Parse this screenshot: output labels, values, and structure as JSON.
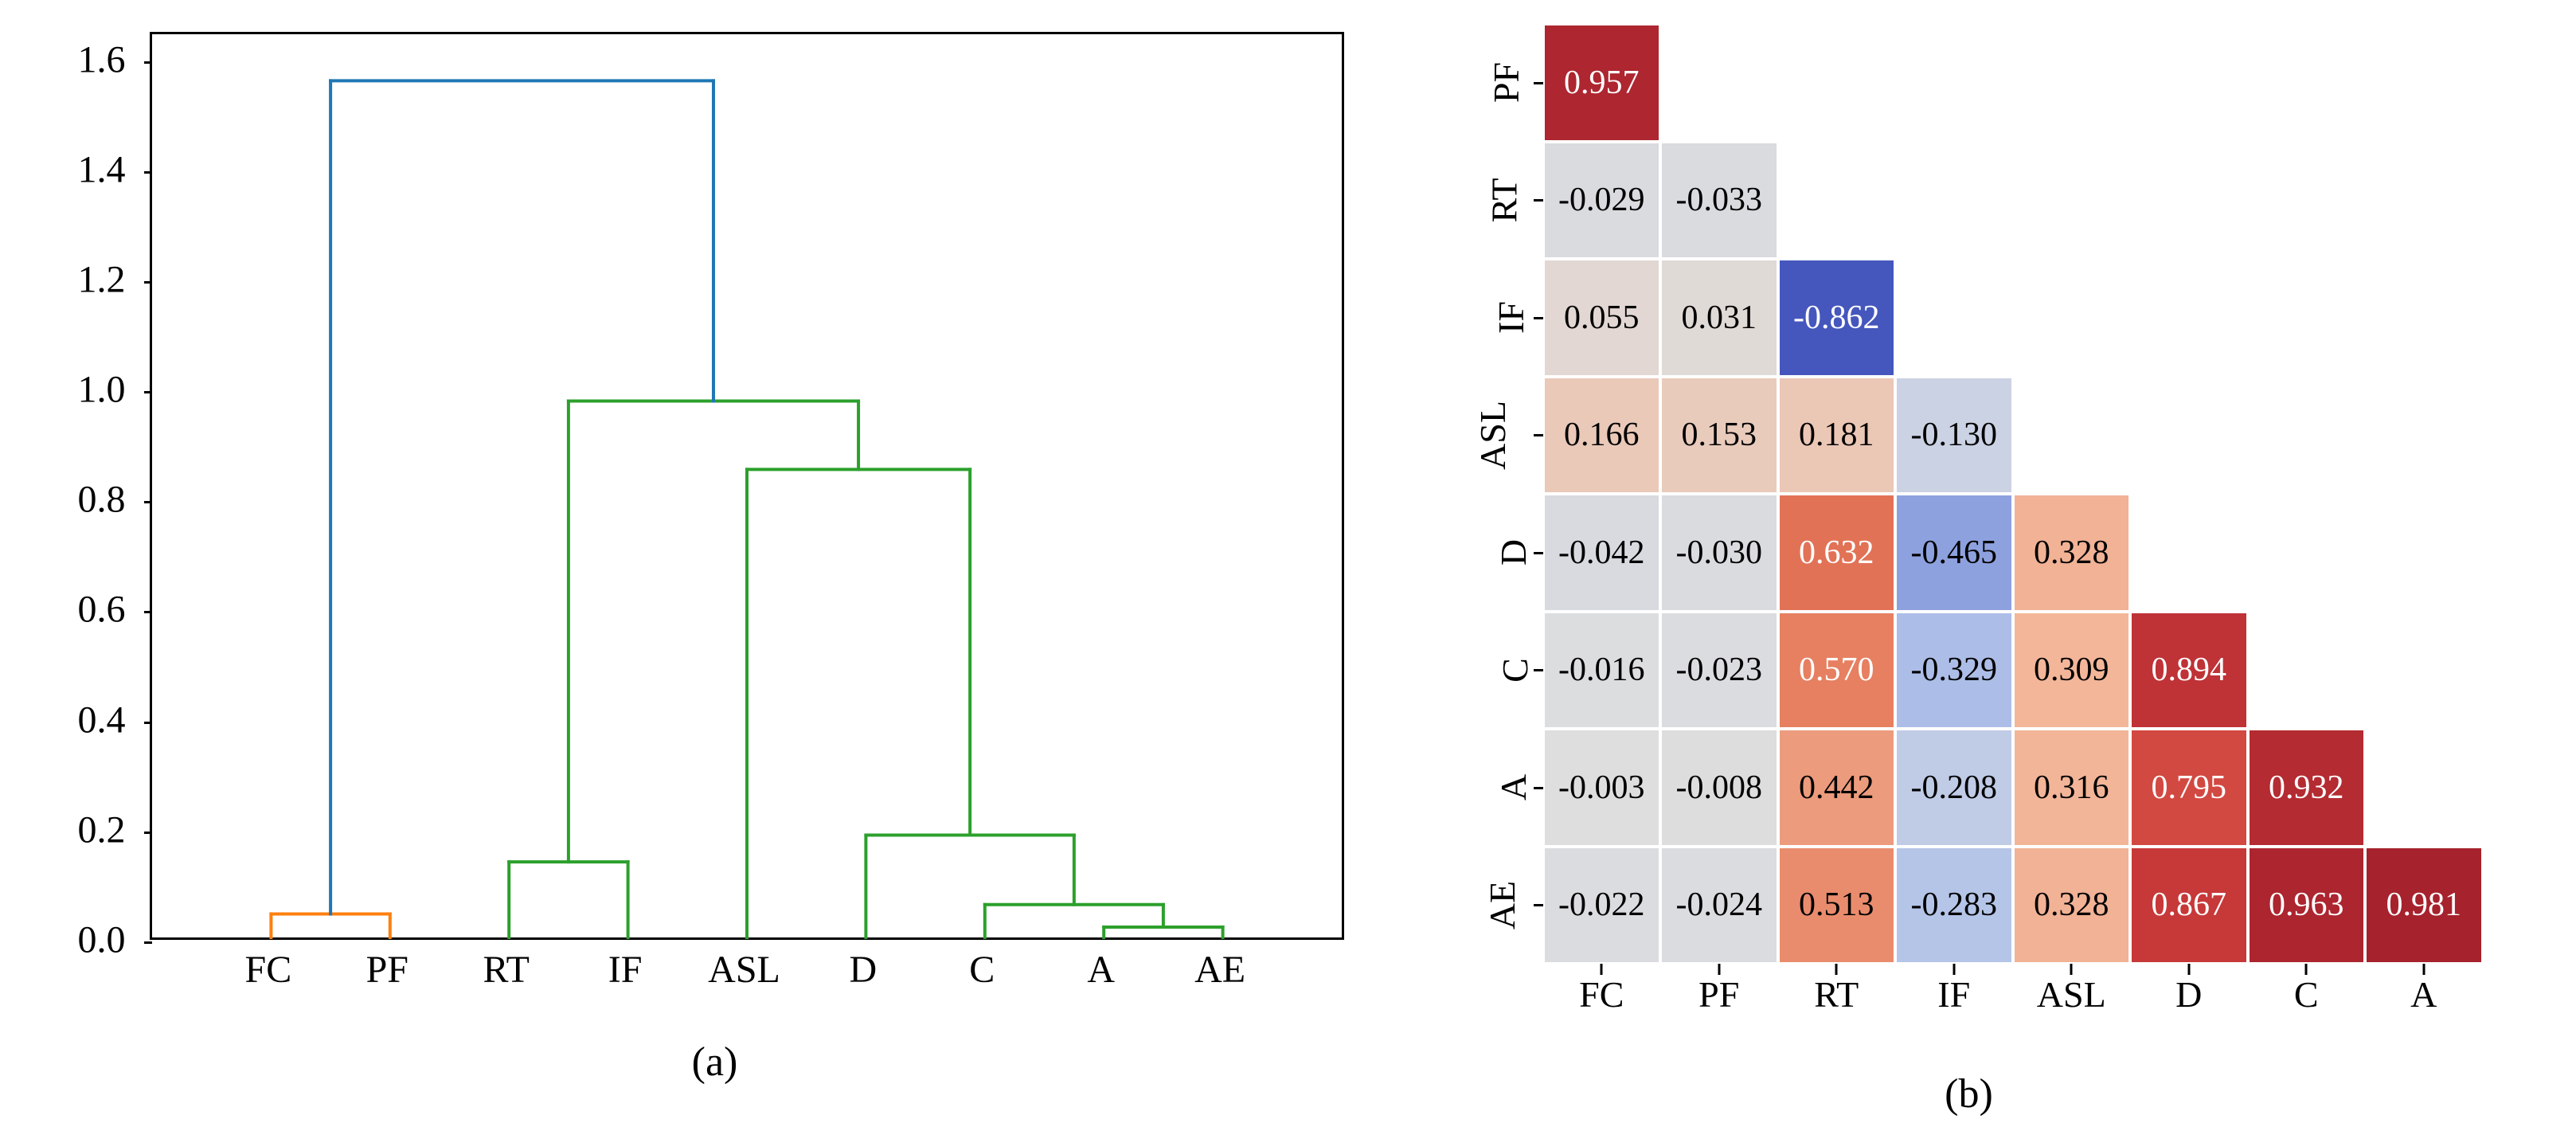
{
  "chart_data": [
    {
      "id": "a",
      "type": "dendrogram",
      "caption": "(a)",
      "y_ticks": [
        0.0,
        0.2,
        0.4,
        0.6,
        0.8,
        1.0,
        1.2,
        1.4,
        1.6
      ],
      "y_range": [
        0.0,
        1.65
      ],
      "leaves": [
        "FC",
        "PF",
        "RT",
        "IF",
        "ASL",
        "D",
        "C",
        "A",
        "AE"
      ],
      "merges": [
        {
          "name": "m1",
          "left": "FC",
          "right": "PF",
          "height": 0.043,
          "color": "#ff7f0e"
        },
        {
          "name": "m2",
          "left": "RT",
          "right": "IF",
          "height": 0.138,
          "color": "#2ca02c"
        },
        {
          "name": "m3",
          "left": "A",
          "right": "AE",
          "height": 0.019,
          "color": "#2ca02c"
        },
        {
          "name": "m4",
          "left": "C",
          "right": "m3",
          "height": 0.06,
          "color": "#2ca02c"
        },
        {
          "name": "m5",
          "left": "D",
          "right": "m4",
          "height": 0.187,
          "color": "#2ca02c"
        },
        {
          "name": "m6",
          "left": "ASL",
          "right": "m5",
          "height": 0.855,
          "color": "#2ca02c"
        },
        {
          "name": "m7",
          "left": "m2",
          "right": "m6",
          "height": 0.98,
          "color": "#2ca02c"
        },
        {
          "name": "m8",
          "left": "m1",
          "right": "m7",
          "height": 1.565,
          "color": "#1f77b4"
        }
      ]
    },
    {
      "id": "b",
      "type": "heatmap",
      "caption": "(b)",
      "x_labels": [
        "FC",
        "PF",
        "RT",
        "IF",
        "ASL",
        "D",
        "C",
        "A"
      ],
      "y_labels": [
        "PF",
        "RT",
        "IF",
        "ASL",
        "D",
        "C",
        "A",
        "AE"
      ],
      "value_range": [
        -1,
        1
      ],
      "colorscale": [
        [
          -1.0,
          "#2f3fb0"
        ],
        [
          -0.6,
          "#6f86d6"
        ],
        [
          -0.3,
          "#b3c3e9"
        ],
        [
          0.0,
          "#dedede"
        ],
        [
          0.3,
          "#f3b89b"
        ],
        [
          0.6,
          "#e57a5a"
        ],
        [
          0.85,
          "#cc3b3b"
        ],
        [
          1.0,
          "#a11e2b"
        ]
      ],
      "cells": [
        [
          0.957,
          null,
          null,
          null,
          null,
          null,
          null,
          null
        ],
        [
          -0.029,
          -0.033,
          null,
          null,
          null,
          null,
          null,
          null
        ],
        [
          0.055,
          0.031,
          -0.862,
          null,
          null,
          null,
          null,
          null
        ],
        [
          0.166,
          0.153,
          0.181,
          -0.13,
          null,
          null,
          null,
          null
        ],
        [
          -0.042,
          -0.03,
          0.632,
          -0.465,
          0.328,
          null,
          null,
          null
        ],
        [
          -0.016,
          -0.023,
          0.57,
          -0.329,
          0.309,
          0.894,
          null,
          null
        ],
        [
          -0.003,
          -0.008,
          0.442,
          -0.208,
          0.316,
          0.795,
          0.932,
          null
        ],
        [
          -0.022,
          -0.024,
          0.513,
          -0.283,
          0.328,
          0.867,
          0.963,
          0.981
        ]
      ]
    }
  ]
}
